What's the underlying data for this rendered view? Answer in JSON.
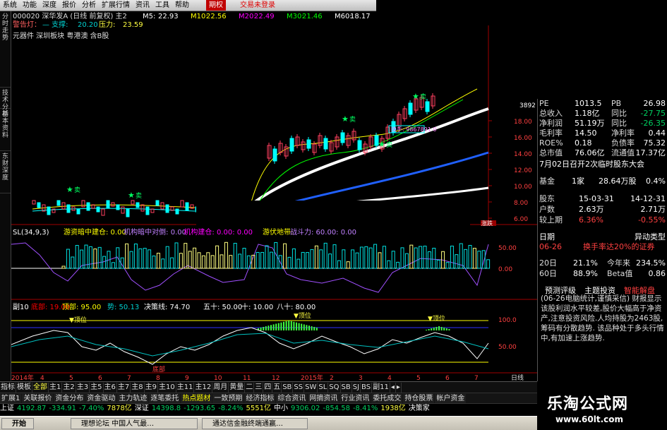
{
  "menu": [
    "系统",
    "功能",
    "深度",
    "报价",
    "分析",
    "扩展行情",
    "资讯",
    "工具",
    "帮助",
    "期权",
    "交易未登录"
  ],
  "sidetabs": [
    "分时走势",
    "技术分析",
    "基本资料",
    "东财深度"
  ],
  "header": {
    "code": "000020 深华发A (日线 前复权) 主2",
    "ma": [
      {
        "label": "M5:",
        "value": "22.93",
        "color": "#ffffff"
      },
      {
        "label": "M10:",
        "value": "22.56",
        "color": "#ffff00"
      },
      {
        "label": "M20:",
        "value": "22.49",
        "color": "#ff00ff"
      },
      {
        "label": "M30:",
        "value": "21.46",
        "color": "#00ff00"
      },
      {
        "label": "M60:",
        "value": "18.17",
        "color": "#ffffff"
      }
    ],
    "warn_label": "警告灯：",
    "support_label": "支撑:",
    "support": "20.20",
    "pressure_label": "压力:",
    "pressure": "23.59",
    "tags": "元器件  深圳板块  粤港澳  含B股"
  },
  "chart_data": [
    {
      "type": "candlestick",
      "y_ticks": [
        "18.00",
        "16.00",
        "14.00",
        "12.00",
        "10.00",
        "8.00",
        "6.00"
      ],
      "top_value": "3892",
      "annotations": [
        {
          "text": "卖",
          "series": "sell"
        },
        {
          "text": "卖",
          "series": "sell"
        },
        {
          "text": "卖",
          "series": "sell"
        },
        {
          "text": "卖",
          "series": "sell"
        },
        {
          "text": "卖",
          "series": "sell"
        },
        {
          "text": "换手: 9867891 0",
          "series": "note"
        }
      ],
      "volume_label": "涨跌"
    },
    {
      "type": "bar",
      "title_parts": [
        {
          "text": "SL(34,9,3)",
          "color": "#ffffff"
        },
        {
          "text": "游资暗中建仓: 0.00",
          "color": "#ffff00"
        },
        {
          "text": "机构暗中对倒: 0.00",
          "color": "#c080ff"
        },
        {
          "text": "机构建仓: 0.00: 0.00",
          "color": "#ff00ff"
        },
        {
          "text": "游伏地带:",
          "color": "#ffff00"
        },
        {
          "text": "战斗力: 60.00: 0.00",
          "color": "#c080ff"
        }
      ],
      "y_ticks": [
        "50.00",
        "0.00"
      ]
    },
    {
      "type": "line",
      "title_parts": [
        {
          "text": "副10",
          "color": "#ffffff"
        },
        {
          "text": "底部: 19.00",
          "color": "#ff0000"
        },
        {
          "text": "顶部: 95.00",
          "color": "#ffff00"
        },
        {
          "text": "势: 50.13",
          "color": "#00d0d0"
        },
        {
          "text": "决策线: 74.70",
          "color": "#ffffff"
        },
        {
          "text": "五十: 50.00",
          "color": "#ffffff"
        },
        {
          "text": "十: 10.00",
          "color": "#ffffff"
        },
        {
          "text": "八十: 80.00",
          "color": "#ffffff"
        }
      ],
      "y_ticks": [
        "100.0",
        "50.00"
      ],
      "annotations": [
        "顶位",
        "顶位",
        "顶位",
        "底部"
      ]
    }
  ],
  "x_axis": [
    "2014年",
    "4",
    "5",
    "6",
    "7",
    "8",
    "9",
    "10",
    "11",
    "12",
    "2015年",
    "2",
    "3",
    "4",
    "5",
    "6",
    "7",
    "日线"
  ],
  "right_panel": {
    "rows": [
      {
        "l": "PE",
        "v1": "1013.5",
        "l2": "PB",
        "v2": "26.98",
        "c1": "w",
        "c2": "w"
      },
      {
        "l": "总收入",
        "v1": "1.18亿",
        "l2": "同比",
        "v2": "-27.75",
        "c1": "w",
        "c2": "g"
      },
      {
        "l": "净利润",
        "v1": "51.19万",
        "l2": "同比",
        "v2": "-26.35",
        "c1": "w",
        "c2": "g"
      },
      {
        "l": "毛利率",
        "v1": "14.50",
        "l2": "净利率",
        "v2": "0.44",
        "c1": "w",
        "c2": "w"
      },
      {
        "l": "ROE%",
        "v1": "0.18",
        "l2": "负债率",
        "v2": "75.32",
        "c1": "w",
        "c2": "w"
      },
      {
        "l": "总市值",
        "v1": "76.06亿",
        "l2": "流通值",
        "v2": "17.37亿",
        "c1": "w",
        "c2": "w"
      }
    ],
    "meeting": "7月02日召开2次临时股东大会",
    "fund": {
      "l": "基金",
      "v1": "1家",
      "v2": "28.64万股",
      "v3": "0.4%"
    },
    "holders": [
      {
        "l": "股东",
        "v1": "15-03-31",
        "v2": "14-12-31",
        "c": "w"
      },
      {
        "l": "户数",
        "v1": "2.63万",
        "v2": "2.71万",
        "c": "w"
      },
      {
        "l": "较上期",
        "v1": "6.36%",
        "v2": "-0.55%",
        "c": "r"
      }
    ],
    "date_head": {
      "l": "日期",
      "r": "异动类型"
    },
    "event": {
      "date": "06-26",
      "text": "换手率达20%的证券"
    },
    "periods": [
      {
        "l": "20日",
        "v1": "21.1%",
        "l2": "今年来",
        "v2": "234.5%"
      },
      {
        "l": "60日",
        "v1": "88.9%",
        "l2": "Beta值",
        "v2": "0.86"
      }
    ],
    "rating_tabs": [
      "预测评级",
      "主题投资",
      "智能解盘"
    ],
    "news": "(06-26电脑统计,谨慎采信) 财报显示该股利润水平较差,股价大幅高于净资产,注意投资风险.人均持股为2463股,筹码有分散趋势. 该品种处于多头行情中,有加速上涨趋势."
  },
  "bottom_tabs": [
    "指标",
    "模板",
    "全部",
    "主1",
    "主2",
    "主3",
    "主5",
    "主6",
    "主7",
    "主8",
    "主9",
    "主10",
    "主11",
    "主12",
    "周月",
    "黄量",
    "二",
    "三",
    "四",
    "五",
    "SB",
    "SS",
    "SW",
    "SL",
    "SQ",
    "SB",
    "SJ",
    "BS",
    "副11",
    "◂",
    "▸"
  ],
  "toolbar": [
    "扩展1",
    "关联报价",
    "资金分布",
    "资金驱动",
    "主力轨迹",
    "逐笔委托",
    "热点题材",
    "一致预期",
    "经济指标",
    "综合资讯",
    "网摘资讯",
    "行业资讯",
    "委托成交",
    "持仓股票",
    "帐户资金"
  ],
  "status": [
    {
      "t": "上证",
      "c": "#ffffff"
    },
    {
      "t": "4192.87",
      "c": "#00d060"
    },
    {
      "t": "-334.91",
      "c": "#00d060"
    },
    {
      "t": "-7.40%",
      "c": "#00d060"
    },
    {
      "t": "7878亿",
      "c": "#ffff40"
    },
    {
      "t": "深证",
      "c": "#ffffff"
    },
    {
      "t": "14398.8",
      "c": "#00d060"
    },
    {
      "t": "-1293.65",
      "c": "#00d060"
    },
    {
      "t": "-8.24%",
      "c": "#00d060"
    },
    {
      "t": "5551亿",
      "c": "#ffff40"
    },
    {
      "t": "中小",
      "c": "#ffffff"
    },
    {
      "t": "9306.02",
      "c": "#00d060"
    },
    {
      "t": "-854.58",
      "c": "#00d060"
    },
    {
      "t": "-8.41%",
      "c": "#00d060"
    },
    {
      "t": "1938亿",
      "c": "#ffff40"
    },
    {
      "t": "决策家",
      "c": "#ffffff"
    }
  ],
  "taskbar": [
    "开始",
    "理想论坛 中国人气最…",
    "通达信金融终端通赢…"
  ],
  "logo": {
    "cn": "乐淘公式网",
    "url": "www.60lt.com"
  }
}
